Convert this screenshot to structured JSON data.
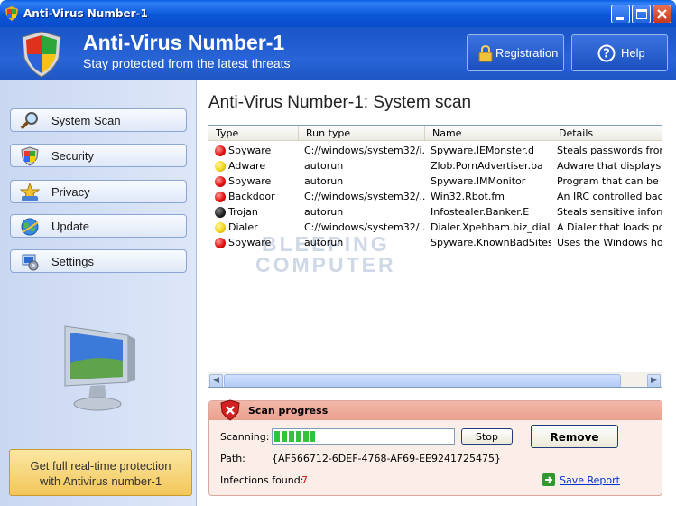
{
  "window": {
    "title": "Anti-Virus Number-1"
  },
  "header": {
    "title": "Anti-Virus Number-1",
    "subtitle": "Stay protected from the latest threats",
    "registration_label": "Registration",
    "help_label": "Help"
  },
  "sidebar": {
    "items": [
      {
        "label": "System Scan",
        "icon": "magnifier-icon"
      },
      {
        "label": "Security",
        "icon": "shield-icon"
      },
      {
        "label": "Privacy",
        "icon": "privacy-icon"
      },
      {
        "label": "Update",
        "icon": "globe-icon"
      },
      {
        "label": "Settings",
        "icon": "settings-icon"
      }
    ],
    "promo_line1": "Get full real-time protection",
    "promo_line2": "with Antivirus number-1"
  },
  "main": {
    "title": "Anti-Virus Number-1: System scan",
    "columns": [
      "Type",
      "Run type",
      "Name",
      "Details"
    ],
    "rows": [
      {
        "severity": "red",
        "type": "Spyware",
        "run_type": "C://windows/system32/i...",
        "name": "Spyware.IEMonster.d",
        "details": "Steals passwords from I"
      },
      {
        "severity": "yellow",
        "type": "Adware",
        "run_type": "autorun",
        "name": "Zlob.PornAdvertiser.ba",
        "details": "Adware that displays pc"
      },
      {
        "severity": "red",
        "type": "Spyware",
        "run_type": "autorun",
        "name": "Spyware.IMMonitor",
        "details": "Program that can be use"
      },
      {
        "severity": "red",
        "type": "Backdoor",
        "run_type": "C://windows/system32/...",
        "name": "Win32.Rbot.fm",
        "details": "An IRC controlled backd"
      },
      {
        "severity": "black",
        "type": "Trojan",
        "run_type": "autorun",
        "name": "Infostealer.Banker.E",
        "details": "Steals sensitive informat"
      },
      {
        "severity": "yellow",
        "type": "Dialer",
        "run_type": "C://windows/system32/...",
        "name": "Dialer.Xpehbam.biz_dialer",
        "details": "A Dialer that loads porne"
      },
      {
        "severity": "red",
        "type": "Spyware",
        "run_type": "autorun",
        "name": "Spyware.KnownBadSites",
        "details": "Uses the Windows hosts"
      }
    ],
    "watermark_line1": "BLEEPING",
    "watermark_line2": "COMPUTER"
  },
  "scan": {
    "header": "Scan progress",
    "scanning_label": "Scanning:",
    "progress_fraction": 0.23,
    "stop_label": "Stop",
    "remove_label": "Remove",
    "path_label": "Path:",
    "path_value": "{AF566712-6DEF-4768-AF69-EE9241725475}",
    "infections_label": "Infections found:",
    "infections_count": "7",
    "save_report_label": "Save Report"
  },
  "colors": {
    "titlebar": "#0b56d6",
    "header": "#2864d6",
    "sidebar": "#d3dff4",
    "promo": "#f3c659",
    "scan_panel": "#fbeee9",
    "infections_count": "#d01010"
  }
}
